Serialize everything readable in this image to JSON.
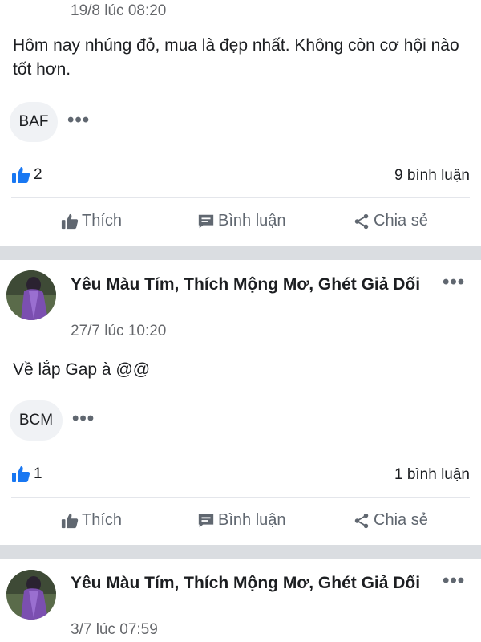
{
  "posts": [
    {
      "timestamp": "19/8 lúc 08:20",
      "text": "Hôm nay nhúng đỏ, mua là đẹp nhất. Không còn cơ hội nào tốt hơn.",
      "tag": "BAF",
      "more": "•••",
      "likes": "2",
      "comments": "9 bình luận"
    },
    {
      "author": "Yêu Màu Tím, Thích Mộng Mơ, Ghét Giả Dối",
      "timestamp": "27/7 lúc 10:20",
      "text": "Về lắp Gap à @@",
      "tag": "BCM",
      "more": "•••",
      "likes": "1",
      "comments": "1 bình luận"
    },
    {
      "author": "Yêu Màu Tím, Thích Mộng Mơ, Ghét Giả Dối",
      "timestamp": "3/7 lúc 07:59",
      "more": "•••"
    }
  ],
  "actions": {
    "like": "Thích",
    "comment": "Bình luận",
    "share": "Chia sẻ"
  },
  "colors": {
    "like_icon": "#1877f2",
    "avatar_purple": "#7b4fb0"
  }
}
